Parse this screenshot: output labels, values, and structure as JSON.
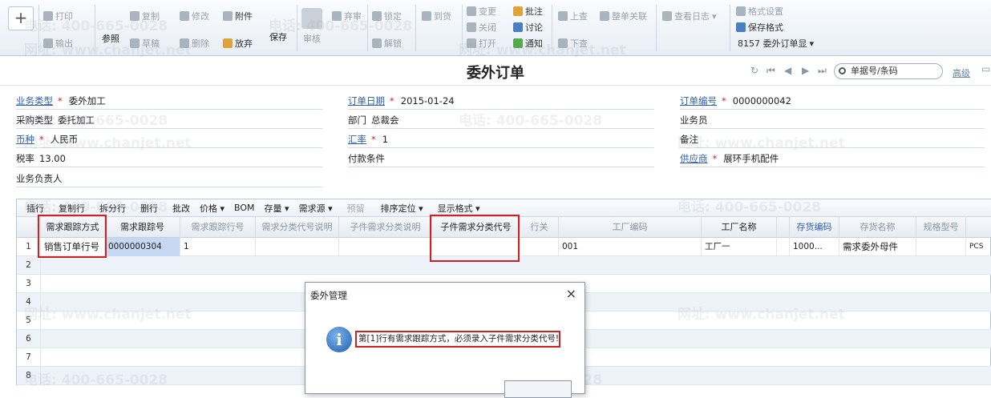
{
  "toolbar": {
    "plus": "+",
    "print": "打印",
    "export": "输出",
    "ref": "参照",
    "copy": "复制",
    "draft": "草稿",
    "modify": "修改",
    "delete": "删除",
    "attach": "附件",
    "abandon": "放弃",
    "save": "保存",
    "audit": "审核",
    "reject": "弃审",
    "lock": "锁定",
    "unlock": "解锁",
    "close_alert": "到货",
    "change": "变更",
    "close": "关闭",
    "open": "打开",
    "annotate": "批注",
    "discuss": "讨论",
    "notify": "通知",
    "prev": "上查",
    "next": "下查",
    "whole_link": "整单关联",
    "view_log": "查看日志",
    "format_settings": "格式设置",
    "save_format": "保存格式",
    "format_select": "8157 委外订单显"
  },
  "header": {
    "title": "委外订单",
    "search_placeholder": "单据号/条码",
    "advanced": "高级"
  },
  "form": {
    "biz_type_label": "业务类型",
    "biz_type": "委外加工",
    "order_date_label": "订单日期",
    "order_date": "2015-01-24",
    "order_no_label": "订单编号",
    "order_no": "0000000042",
    "purchase_type_label": "采购类型",
    "purchase_type": "委托加工",
    "dept_label": "部门",
    "dept": "总裁会",
    "salesman_label": "业务员",
    "currency_label": "币种",
    "currency": "人民币",
    "rate_label": "汇率",
    "rate": "1",
    "remark_label": "备注",
    "tax_label": "税率",
    "tax": "13.00",
    "payment_label": "付款条件",
    "supplier_label": "供应商",
    "supplier": "展环手机配件",
    "owner_label": "业务负责人"
  },
  "grid_toolbar": [
    "插行",
    "复制行",
    "拆分行",
    "删行",
    "批改",
    "价格 ▾",
    "BOM",
    "存量 ▾",
    "需求源 ▾",
    "预留",
    "排序定位 ▾",
    "显示格式 ▾"
  ],
  "grid": {
    "headers": [
      "需求跟踪方式",
      "需求跟踪号",
      "需求跟踪行号",
      "需求分类代号说明",
      "子件需求分类说明",
      "子件需求分类代号",
      "行关",
      "工厂编码",
      "工厂名称",
      "存货编码",
      "存货名称",
      "规格型号"
    ],
    "row1": {
      "num": "1",
      "track_mode": "销售订单行号",
      "track_no": "0000000304",
      "track_line": "1",
      "factory_code": "001",
      "factory_name": "工厂一",
      "inv_code": "1000...",
      "inv_name": "需求委外母件",
      "unit": "PCS"
    },
    "row_numbers": [
      "2",
      "3",
      "4",
      "5",
      "6",
      "7",
      "8"
    ]
  },
  "dialog": {
    "title": "委外管理",
    "close": "×",
    "icon": "i",
    "message": "第[1]行有需求跟踪方式，必须录入子件需求分类代号!"
  },
  "watermark": {
    "phone": "电话: 400-665-0028",
    "site": "网址: www.chanjet.net"
  }
}
